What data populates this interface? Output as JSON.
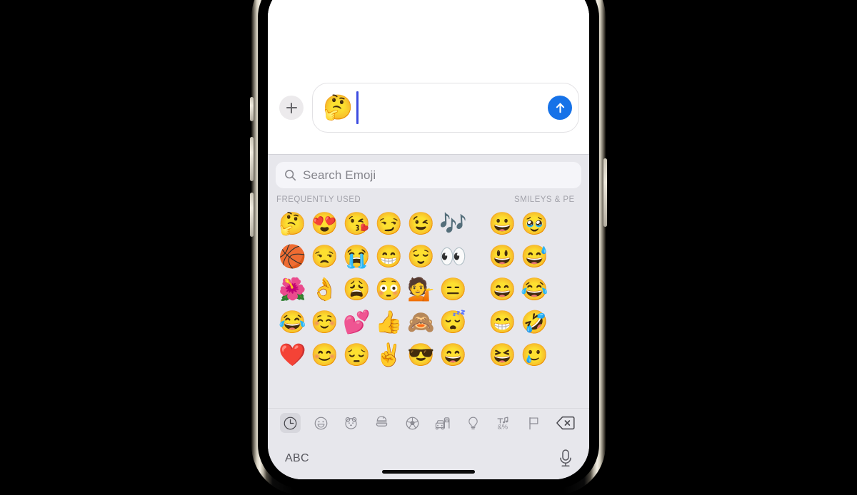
{
  "device": {
    "name": "iPhone",
    "buttons": [
      "ringer-switch",
      "volume-up-button",
      "volume-down-button",
      "power-button"
    ]
  },
  "compose": {
    "add_button_label": "+",
    "input_value": "🤔",
    "send_button_label": "Send",
    "send_icon": "arrow-up-icon",
    "accent_color": "#1672e8",
    "caret_color": "#3d4de0"
  },
  "keyboard": {
    "background_color": "#e7e7ec",
    "search": {
      "placeholder": "Search Emoji",
      "value": "",
      "icon": "search-icon"
    },
    "sections": [
      {
        "id": "frequently-used",
        "title": "FREQUENTLY USED",
        "columns": 6,
        "emojis": [
          "🤔",
          "😍",
          "😘",
          "😏",
          "😉",
          "🎶",
          "🏀",
          "😒",
          "😭",
          "😁",
          "😌",
          "👀",
          "🌺",
          "👌",
          "😩",
          "😳",
          "💁",
          "😑",
          "😂",
          "☺️",
          "💕",
          "👍",
          "🙈",
          "😴",
          "❤️",
          "😊",
          "😔",
          "✌️",
          "😎",
          "😄"
        ]
      },
      {
        "id": "smileys-and-people",
        "title": "SMILEYS & PE",
        "columns": 2,
        "emojis": [
          "😀",
          "🥹",
          "😃",
          "😅",
          "😄",
          "😂",
          "😁",
          "🤣",
          "😆",
          "🥲"
        ]
      }
    ],
    "categories": [
      {
        "id": "recently-used",
        "icon": "clock-icon",
        "label": "Recently Used",
        "selected": true
      },
      {
        "id": "smileys-people",
        "icon": "smiley-icon",
        "label": "Smileys & People",
        "selected": false
      },
      {
        "id": "animals-nature",
        "icon": "bear-icon",
        "label": "Animals & Nature",
        "selected": false
      },
      {
        "id": "food-drink",
        "icon": "food-icon",
        "label": "Food & Drink",
        "selected": false
      },
      {
        "id": "activity",
        "icon": "soccer-ball-icon",
        "label": "Activity",
        "selected": false
      },
      {
        "id": "travel-places",
        "icon": "car-icon",
        "label": "Travel & Places",
        "selected": false
      },
      {
        "id": "objects",
        "icon": "lightbulb-icon",
        "label": "Objects",
        "selected": false
      },
      {
        "id": "symbols",
        "icon": "symbols-icon",
        "label": "Symbols",
        "selected": false
      },
      {
        "id": "flags",
        "icon": "flag-icon",
        "label": "Flags",
        "selected": false
      }
    ],
    "delete_key": {
      "icon": "delete-backward-icon",
      "label": "Delete"
    },
    "bottom": {
      "abc_key_label": "ABC",
      "dictation_icon": "microphone-icon",
      "home_indicator": true
    }
  }
}
